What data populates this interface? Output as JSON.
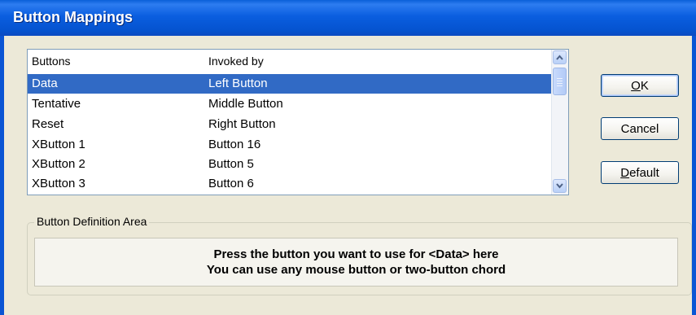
{
  "window": {
    "title": "Button Mappings"
  },
  "list": {
    "headers": {
      "buttons": "Buttons",
      "invoked_by": "Invoked by"
    },
    "rows": [
      {
        "button": "Data",
        "invoked": "Left Button",
        "selected": true
      },
      {
        "button": "Tentative",
        "invoked": "Middle Button",
        "selected": false
      },
      {
        "button": "Reset",
        "invoked": "Right Button",
        "selected": false
      },
      {
        "button": "XButton 1",
        "invoked": "Button 16",
        "selected": false
      },
      {
        "button": "XButton 2",
        "invoked": "Button 5",
        "selected": false
      },
      {
        "button": "XButton 3",
        "invoked": "Button 6",
        "selected": false
      }
    ]
  },
  "buttons": {
    "ok": {
      "mnemonic": "O",
      "rest": "K"
    },
    "cancel": "Cancel",
    "default": {
      "mnemonic": "D",
      "rest": "efault"
    }
  },
  "definition_area": {
    "label": "Button Definition Area",
    "line1": "Press the button you want to use for <Data> here",
    "line2": "You can use any mouse button or two-button chord"
  },
  "colors": {
    "titlebar": "#0a5ee0",
    "selection": "#316ac5",
    "dialog_bg": "#ece9d8"
  }
}
